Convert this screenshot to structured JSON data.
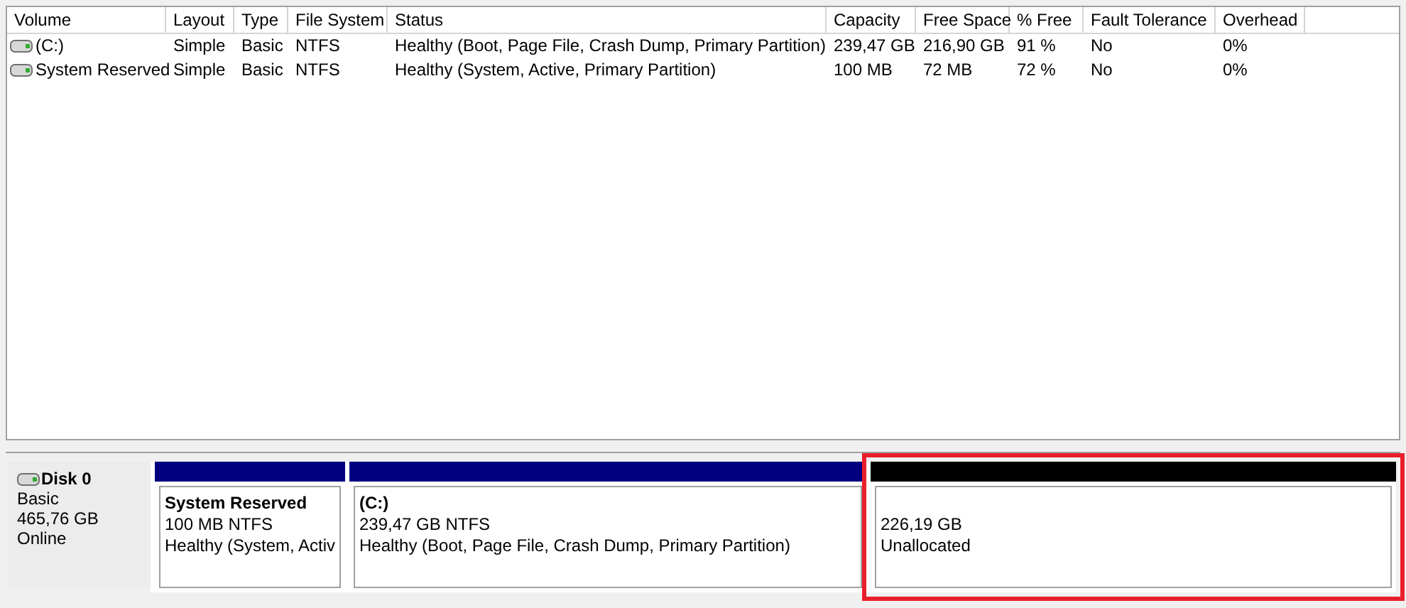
{
  "volume_table": {
    "columns": [
      "Volume",
      "Layout",
      "Type",
      "File System",
      "Status",
      "Capacity",
      "Free Space",
      "% Free",
      "Fault Tolerance",
      "Overhead"
    ],
    "rows": [
      {
        "cells": [
          "(C:)",
          "Simple",
          "Basic",
          "NTFS",
          "Healthy (Boot, Page File, Crash Dump, Primary Partition)",
          "239,47 GB",
          "216,90 GB",
          "91 %",
          "No",
          "0%"
        ]
      },
      {
        "cells": [
          "System Reserved",
          "Simple",
          "Basic",
          "NTFS",
          "Healthy (System, Active, Primary Partition)",
          "100 MB",
          "72 MB",
          "72 %",
          "No",
          "0%"
        ]
      }
    ]
  },
  "disks": [
    {
      "name": "Disk 0",
      "type": "Basic",
      "size": "465,76 GB",
      "status": "Online",
      "partitions": [
        {
          "kind": "primary",
          "title": "System Reserved",
          "size": "100 MB NTFS",
          "status": "Healthy (System, Activ",
          "highlighted": false
        },
        {
          "kind": "primary",
          "title": "(C:)",
          "size": "239,47 GB NTFS",
          "status": "Healthy (Boot, Page File, Crash Dump, Primary Partition)",
          "highlighted": false
        },
        {
          "kind": "unallocated",
          "size": "226,19 GB",
          "status": "Unallocated",
          "highlighted": true
        }
      ]
    }
  ]
}
